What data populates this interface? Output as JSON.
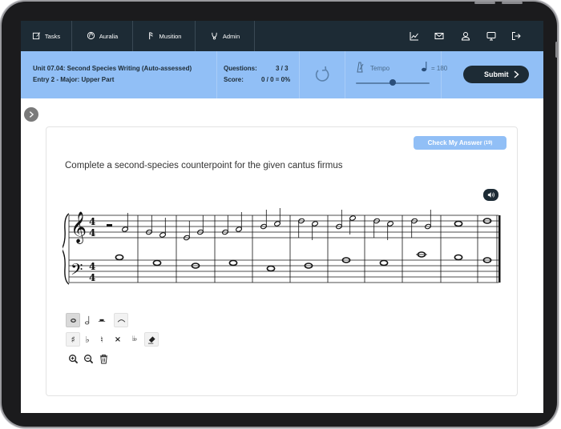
{
  "nav": {
    "tabs": [
      {
        "label": "Tasks",
        "icon": "edit-icon"
      },
      {
        "label": "Auralia",
        "icon": "auralia-logo-icon"
      },
      {
        "label": "Musition",
        "icon": "musition-logo-icon"
      },
      {
        "label": "Admin",
        "icon": "admin-icon"
      }
    ],
    "right_icons": [
      "chart-icon",
      "mail-icon",
      "user-icon",
      "monitor-icon",
      "logout-icon"
    ]
  },
  "task": {
    "title": "Unit 07.04: Second Species Writing (Auto-assessed)",
    "subtitle": "Entry 2 - Major: Upper Part",
    "questions_label": "Questions:",
    "questions_value": "3 / 3",
    "score_label": "Score:",
    "score_value": "0 / 0 = 0%"
  },
  "tempo": {
    "label": "Tempo",
    "bpm_text": "= 180",
    "bpm": 180,
    "slider_level": 0.5
  },
  "submit_label": "Submit",
  "check_answer": {
    "label": "Check My Answer",
    "count": "(19)"
  },
  "instruction": "Complete a second-species counterpoint for the given cantus firmus",
  "score": {
    "time_signature": "4/4",
    "treble_clef": "𝄞",
    "bass_clef": "𝄢"
  },
  "toolbars": {
    "durations": [
      "whole-note-icon",
      "half-note-icon",
      "whole-rest-icon",
      "tie-icon"
    ],
    "accidentals": [
      {
        "name": "sharp-icon",
        "glyph": "♯"
      },
      {
        "name": "flat-icon",
        "glyph": "♭"
      },
      {
        "name": "natural-icon",
        "glyph": "♮"
      },
      {
        "name": "double-sharp-icon",
        "glyph": "×"
      },
      {
        "name": "double-flat-icon",
        "glyph": "♭♭"
      },
      {
        "name": "eraser-icon",
        "glyph": ""
      }
    ],
    "view": [
      "zoom-in-icon",
      "zoom-out-icon",
      "trash-icon"
    ]
  },
  "colors": {
    "nav_bg": "#1d2b35",
    "info_bg": "#91bff6",
    "accent": "#91bff6"
  }
}
